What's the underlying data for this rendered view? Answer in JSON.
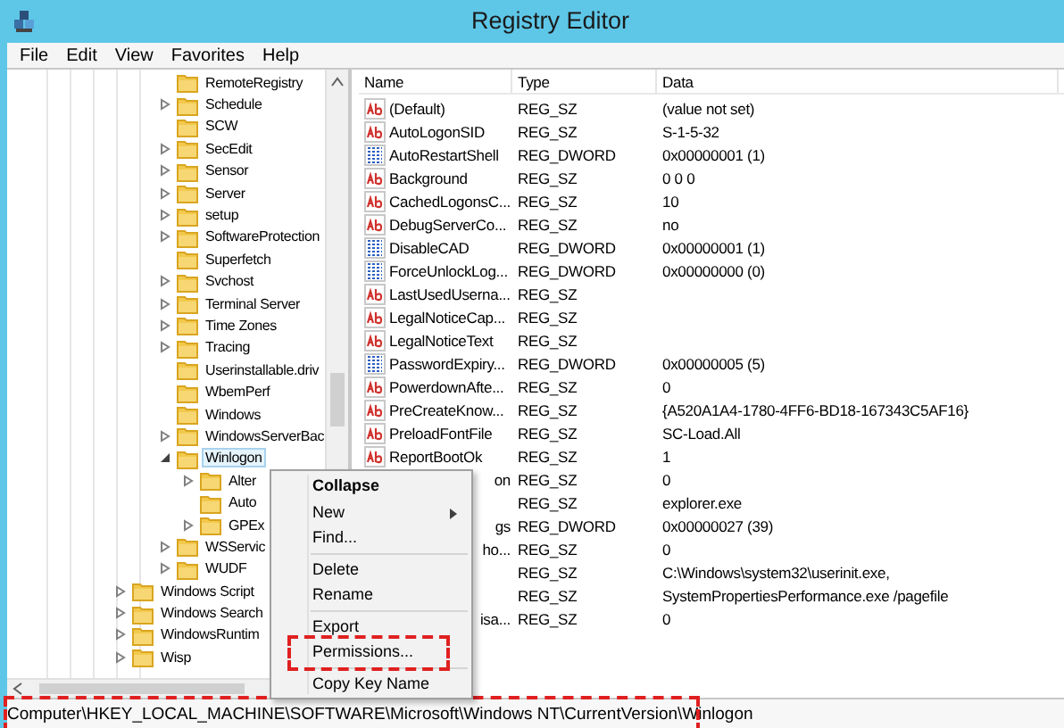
{
  "window": {
    "title": "Registry Editor"
  },
  "menu_bar": [
    "File",
    "Edit",
    "View",
    "Favorites",
    "Help"
  ],
  "tree": {
    "items": [
      {
        "label": "RemoteRegistry",
        "selected": false
      },
      {
        "label": "Schedule",
        "expanded": false,
        "selected": false
      },
      {
        "label": "SCW",
        "selected": false
      },
      {
        "label": "SecEdit",
        "expanded": false,
        "selected": false
      },
      {
        "label": "Sensor",
        "expanded": false,
        "selected": false
      },
      {
        "label": "Server",
        "expanded": false,
        "selected": false
      },
      {
        "label": "setup",
        "expanded": false,
        "selected": false
      },
      {
        "label": "SoftwareProtection",
        "expanded": false,
        "selected": false
      },
      {
        "label": "Superfetch",
        "selected": false
      },
      {
        "label": "Svchost",
        "expanded": false,
        "selected": false
      },
      {
        "label": "Terminal Server",
        "expanded": false,
        "selected": false
      },
      {
        "label": "Time Zones",
        "expanded": false,
        "selected": false
      },
      {
        "label": "Tracing",
        "expanded": false,
        "selected": false
      },
      {
        "label": "Userinstallable.driv",
        "selected": false
      },
      {
        "label": "WbemPerf",
        "selected": false
      },
      {
        "label": "Windows",
        "selected": false
      },
      {
        "label": "WindowsServerBac",
        "expanded": false,
        "selected": false
      },
      {
        "label": "Winlogon",
        "expanded": true,
        "selected": true,
        "children": [
          {
            "label": "Alter",
            "expanded": false,
            "selected": false
          },
          {
            "label": "Auto",
            "selected": false
          },
          {
            "label": "GPEx",
            "expanded": false,
            "selected": false
          }
        ]
      },
      {
        "label": "WSServic",
        "expanded": false,
        "selected": false
      },
      {
        "label": "WUDF",
        "expanded": false,
        "selected": false
      }
    ],
    "parent_level_items": [
      {
        "label": "Windows Script",
        "expanded": false,
        "selected": false
      },
      {
        "label": "Windows Search",
        "expanded": false,
        "selected": false
      },
      {
        "label": "WindowsRuntim",
        "expanded": false,
        "selected": false
      },
      {
        "label": "Wisp",
        "expanded": false,
        "selected": false
      }
    ]
  },
  "values_table": {
    "columns": [
      "Name",
      "Type",
      "Data"
    ],
    "rows": [
      {
        "kind": "string",
        "name": "(Default)",
        "type": "REG_SZ",
        "data": "(value not set)"
      },
      {
        "kind": "string",
        "name": "AutoLogonSID",
        "type": "REG_SZ",
        "data": "S-1-5-32"
      },
      {
        "kind": "binary",
        "name": "AutoRestartShell",
        "type": "REG_DWORD",
        "data": "0x00000001 (1)"
      },
      {
        "kind": "string",
        "name": "Background",
        "type": "REG_SZ",
        "data": "0 0 0"
      },
      {
        "kind": "string",
        "name": "CachedLogonsC...",
        "type": "REG_SZ",
        "data": "10"
      },
      {
        "kind": "string",
        "name": "DebugServerCo...",
        "type": "REG_SZ",
        "data": "no"
      },
      {
        "kind": "binary",
        "name": "DisableCAD",
        "type": "REG_DWORD",
        "data": "0x00000001 (1)"
      },
      {
        "kind": "binary",
        "name": "ForceUnlockLog...",
        "type": "REG_DWORD",
        "data": "0x00000000 (0)"
      },
      {
        "kind": "string",
        "name": "LastUsedUserna...",
        "type": "REG_SZ"
      },
      {
        "kind": "string",
        "name": "LegalNoticeCap...",
        "type": "REG_SZ"
      },
      {
        "kind": "string",
        "name": "LegalNoticeText",
        "type": "REG_SZ"
      },
      {
        "kind": "binary",
        "name": "PasswordExpiry...",
        "type": "REG_DWORD",
        "data": "0x00000005 (5)"
      },
      {
        "kind": "string",
        "name": "PowerdownAfte...",
        "type": "REG_SZ",
        "data": "0"
      },
      {
        "kind": "string",
        "name": "PreCreateKnow...",
        "type": "REG_SZ",
        "data": "{A520A1A4-1780-4FF6-BD18-167343C5AF16}"
      },
      {
        "kind": "string",
        "name": "PreloadFontFile",
        "type": "REG_SZ",
        "data": "SC-Load.All"
      },
      {
        "kind": "string",
        "name": "ReportBootOk",
        "type": "REG_SZ",
        "data": "1"
      },
      {
        "kind": "covered",
        "name": "on",
        "type": "REG_SZ",
        "data": "0"
      },
      {
        "kind": "covered",
        "type": "REG_SZ",
        "data": "explorer.exe"
      },
      {
        "kind": "covered",
        "name": "gs",
        "type": "REG_DWORD",
        "data": "0x00000027 (39)"
      },
      {
        "kind": "covered",
        "name": "ho...",
        "type": "REG_SZ",
        "data": "0"
      },
      {
        "kind": "covered",
        "type": "REG_SZ",
        "data": "C:\\Windows\\system32\\userinit.exe,"
      },
      {
        "kind": "covered",
        "type": "REG_SZ",
        "data": "SystemPropertiesPerformance.exe /pagefile"
      },
      {
        "kind": "covered",
        "name": "isa...",
        "type": "REG_SZ",
        "data": "0"
      }
    ]
  },
  "context_menu": [
    {
      "kind": "item",
      "label": "Collapse",
      "default": true
    },
    {
      "kind": "item",
      "label": "New",
      "submenu": true
    },
    {
      "kind": "item",
      "label": "Find..."
    },
    {
      "kind": "separator"
    },
    {
      "kind": "item",
      "label": "Delete"
    },
    {
      "kind": "item",
      "label": "Rename"
    },
    {
      "kind": "separator"
    },
    {
      "kind": "item",
      "label": "Export"
    },
    {
      "kind": "item",
      "label": "Permissions...",
      "marked": true
    },
    {
      "kind": "separator"
    },
    {
      "kind": "item",
      "label": "Copy Key Name"
    }
  ],
  "status_bar": {
    "path": "Computer\\HKEY_LOCAL_MACHINE\\SOFTWARE\\Microsoft\\Windows NT\\CurrentVersion\\Winlogon",
    "marked": true
  }
}
